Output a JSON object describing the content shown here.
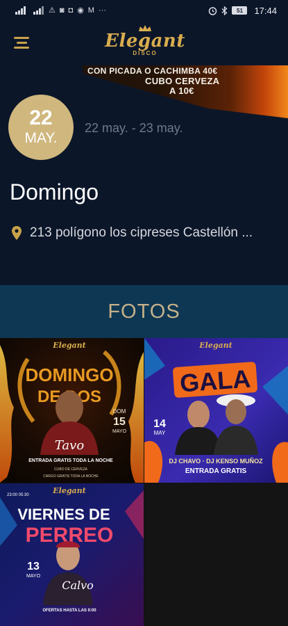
{
  "status_bar": {
    "time": "17:44",
    "battery": "51",
    "left_icons": [
      "signal-icon",
      "signal-icon",
      "warning-icon",
      "instagram-icon",
      "camera-icon",
      "messenger-icon",
      "gmail-icon",
      "more-icon"
    ],
    "right_icons": [
      "alarm-icon",
      "bluetooth-icon",
      "battery-icon"
    ]
  },
  "header": {
    "logo_text": "Elegant",
    "logo_sub": "DISCO"
  },
  "banner": {
    "line1": "CON PICADA O CACHIMBA 40€",
    "line2": "CUBO CERVEZA",
    "line3": "A 10€"
  },
  "event": {
    "day": "22",
    "month": "MAY.",
    "date_range": "22 may. - 23 may.",
    "title": "Domingo",
    "address": "213 polígono los cipreses Castellón ..."
  },
  "fotos": {
    "title": "FOTOS",
    "photos": [
      {
        "name": "DOMINGO DE DOS",
        "day": "15",
        "month": "MAYO",
        "weekday": "DOM",
        "artist": "Tavo",
        "line1": "ENTRADA GRATIS TODA LA NOCHE",
        "line2": "CUBO DE CERVEZA",
        "line3": "CARGO GRATIS TODA LA NOCHE"
      },
      {
        "name": "GALA",
        "day": "14",
        "month": "MAY",
        "djs": "DJ CHAVO · DJ KENSO MUÑOZ",
        "entry": "ENTRADA GRATIS"
      },
      {
        "name": "VIERNES DE PERREO",
        "day": "13",
        "month": "MAYO",
        "time": "23:00 05:30",
        "artist": "Calvo",
        "line1": "OFERTAS HASTA LAS 0:00"
      }
    ]
  },
  "colors": {
    "background": "#0c1629",
    "accent_gold": "#c9a24a",
    "date_badge": "#cfb77e",
    "fotos_bar": "#0e3753"
  }
}
